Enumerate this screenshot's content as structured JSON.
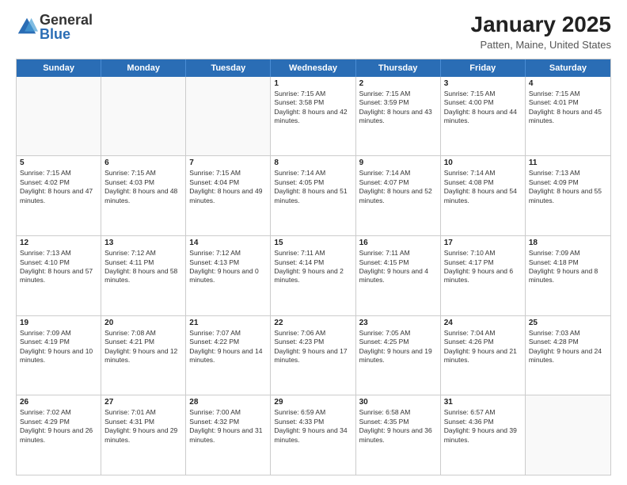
{
  "logo": {
    "general": "General",
    "blue": "Blue"
  },
  "header": {
    "month_year": "January 2025",
    "location": "Patten, Maine, United States"
  },
  "weekdays": [
    "Sunday",
    "Monday",
    "Tuesday",
    "Wednesday",
    "Thursday",
    "Friday",
    "Saturday"
  ],
  "rows": [
    [
      {
        "day": "",
        "text": ""
      },
      {
        "day": "",
        "text": ""
      },
      {
        "day": "",
        "text": ""
      },
      {
        "day": "1",
        "text": "Sunrise: 7:15 AM\nSunset: 3:58 PM\nDaylight: 8 hours and 42 minutes."
      },
      {
        "day": "2",
        "text": "Sunrise: 7:15 AM\nSunset: 3:59 PM\nDaylight: 8 hours and 43 minutes."
      },
      {
        "day": "3",
        "text": "Sunrise: 7:15 AM\nSunset: 4:00 PM\nDaylight: 8 hours and 44 minutes."
      },
      {
        "day": "4",
        "text": "Sunrise: 7:15 AM\nSunset: 4:01 PM\nDaylight: 8 hours and 45 minutes."
      }
    ],
    [
      {
        "day": "5",
        "text": "Sunrise: 7:15 AM\nSunset: 4:02 PM\nDaylight: 8 hours and 47 minutes."
      },
      {
        "day": "6",
        "text": "Sunrise: 7:15 AM\nSunset: 4:03 PM\nDaylight: 8 hours and 48 minutes."
      },
      {
        "day": "7",
        "text": "Sunrise: 7:15 AM\nSunset: 4:04 PM\nDaylight: 8 hours and 49 minutes."
      },
      {
        "day": "8",
        "text": "Sunrise: 7:14 AM\nSunset: 4:05 PM\nDaylight: 8 hours and 51 minutes."
      },
      {
        "day": "9",
        "text": "Sunrise: 7:14 AM\nSunset: 4:07 PM\nDaylight: 8 hours and 52 minutes."
      },
      {
        "day": "10",
        "text": "Sunrise: 7:14 AM\nSunset: 4:08 PM\nDaylight: 8 hours and 54 minutes."
      },
      {
        "day": "11",
        "text": "Sunrise: 7:13 AM\nSunset: 4:09 PM\nDaylight: 8 hours and 55 minutes."
      }
    ],
    [
      {
        "day": "12",
        "text": "Sunrise: 7:13 AM\nSunset: 4:10 PM\nDaylight: 8 hours and 57 minutes."
      },
      {
        "day": "13",
        "text": "Sunrise: 7:12 AM\nSunset: 4:11 PM\nDaylight: 8 hours and 58 minutes."
      },
      {
        "day": "14",
        "text": "Sunrise: 7:12 AM\nSunset: 4:13 PM\nDaylight: 9 hours and 0 minutes."
      },
      {
        "day": "15",
        "text": "Sunrise: 7:11 AM\nSunset: 4:14 PM\nDaylight: 9 hours and 2 minutes."
      },
      {
        "day": "16",
        "text": "Sunrise: 7:11 AM\nSunset: 4:15 PM\nDaylight: 9 hours and 4 minutes."
      },
      {
        "day": "17",
        "text": "Sunrise: 7:10 AM\nSunset: 4:17 PM\nDaylight: 9 hours and 6 minutes."
      },
      {
        "day": "18",
        "text": "Sunrise: 7:09 AM\nSunset: 4:18 PM\nDaylight: 9 hours and 8 minutes."
      }
    ],
    [
      {
        "day": "19",
        "text": "Sunrise: 7:09 AM\nSunset: 4:19 PM\nDaylight: 9 hours and 10 minutes."
      },
      {
        "day": "20",
        "text": "Sunrise: 7:08 AM\nSunset: 4:21 PM\nDaylight: 9 hours and 12 minutes."
      },
      {
        "day": "21",
        "text": "Sunrise: 7:07 AM\nSunset: 4:22 PM\nDaylight: 9 hours and 14 minutes."
      },
      {
        "day": "22",
        "text": "Sunrise: 7:06 AM\nSunset: 4:23 PM\nDaylight: 9 hours and 17 minutes."
      },
      {
        "day": "23",
        "text": "Sunrise: 7:05 AM\nSunset: 4:25 PM\nDaylight: 9 hours and 19 minutes."
      },
      {
        "day": "24",
        "text": "Sunrise: 7:04 AM\nSunset: 4:26 PM\nDaylight: 9 hours and 21 minutes."
      },
      {
        "day": "25",
        "text": "Sunrise: 7:03 AM\nSunset: 4:28 PM\nDaylight: 9 hours and 24 minutes."
      }
    ],
    [
      {
        "day": "26",
        "text": "Sunrise: 7:02 AM\nSunset: 4:29 PM\nDaylight: 9 hours and 26 minutes."
      },
      {
        "day": "27",
        "text": "Sunrise: 7:01 AM\nSunset: 4:31 PM\nDaylight: 9 hours and 29 minutes."
      },
      {
        "day": "28",
        "text": "Sunrise: 7:00 AM\nSunset: 4:32 PM\nDaylight: 9 hours and 31 minutes."
      },
      {
        "day": "29",
        "text": "Sunrise: 6:59 AM\nSunset: 4:33 PM\nDaylight: 9 hours and 34 minutes."
      },
      {
        "day": "30",
        "text": "Sunrise: 6:58 AM\nSunset: 4:35 PM\nDaylight: 9 hours and 36 minutes."
      },
      {
        "day": "31",
        "text": "Sunrise: 6:57 AM\nSunset: 4:36 PM\nDaylight: 9 hours and 39 minutes."
      },
      {
        "day": "",
        "text": ""
      }
    ]
  ]
}
